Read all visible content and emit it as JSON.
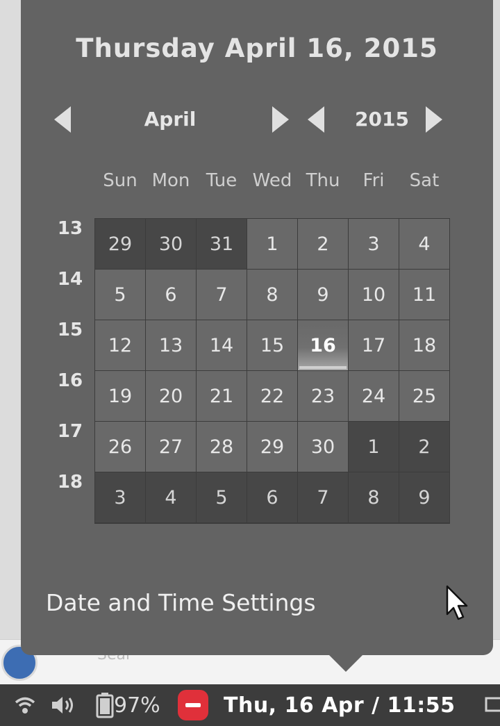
{
  "calendar": {
    "date_title": "Thursday April 16, 2015",
    "month_label": "April",
    "year_label": "2015",
    "weekdays": [
      "Sun",
      "Mon",
      "Tue",
      "Wed",
      "Thu",
      "Fri",
      "Sat"
    ],
    "week_numbers": [
      "13",
      "14",
      "15",
      "16",
      "17",
      "18"
    ],
    "days": [
      [
        "29",
        "30",
        "31",
        "1",
        "2",
        "3",
        "4"
      ],
      [
        "5",
        "6",
        "7",
        "8",
        "9",
        "10",
        "11"
      ],
      [
        "12",
        "13",
        "14",
        "15",
        "16",
        "17",
        "18"
      ],
      [
        "19",
        "20",
        "21",
        "22",
        "23",
        "24",
        "25"
      ],
      [
        "26",
        "27",
        "28",
        "29",
        "30",
        "1",
        "2"
      ],
      [
        "3",
        "4",
        "5",
        "6",
        "7",
        "8",
        "9"
      ]
    ],
    "settings_link": "Date and Time Settings"
  },
  "background": {
    "search_text": "Sear"
  },
  "taskbar": {
    "battery_pct": "97%",
    "clock": "Thu, 16 Apr / 11:55",
    "icons": [
      "wifi-icon",
      "volume-icon",
      "battery-icon",
      "do-not-disturb-icon"
    ]
  },
  "colors": {
    "popup_bg": "#636363",
    "taskbar_bg": "#3c3c3c",
    "dnd_red": "#e0303a"
  }
}
